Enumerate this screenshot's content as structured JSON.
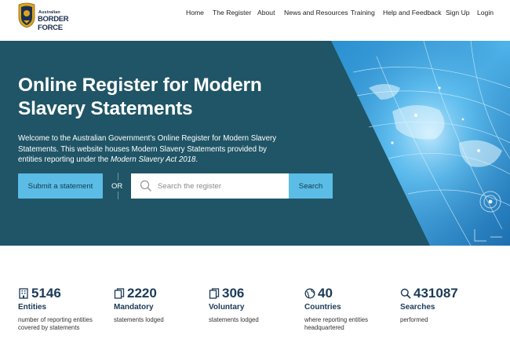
{
  "logo": {
    "small_text": "Australian",
    "big_text": "BORDER FORCE"
  },
  "nav": [
    {
      "label": "Home"
    },
    {
      "label": "The Register"
    },
    {
      "label": "About"
    },
    {
      "label": "News and Resources"
    },
    {
      "label": "Training"
    },
    {
      "label": "Help and Feedback"
    },
    {
      "label": "Sign Up"
    },
    {
      "label": "Login"
    }
  ],
  "hero": {
    "title": "Online Register for Modern Slavery Statements",
    "description": "Welcome to the Australian Government's Online Register for Modern Slavery Statements. This website houses Modern Slavery Statements provided by entities reporting under the ",
    "act_name": "Modern Slavery Act 2018",
    "description_end": ".",
    "submit_label": "Submit a statement",
    "or_label": "OR",
    "search_placeholder": "Search the register",
    "search_label": "Search"
  },
  "colors": {
    "hero_bg": "#1f5566",
    "accent": "#5bbce6",
    "navy": "#1b3a57"
  },
  "stats": [
    {
      "icon": "building-icon",
      "value": "5146",
      "label": "Entities",
      "description": "number of reporting entities covered by statements"
    },
    {
      "icon": "documents-icon",
      "value": "2220",
      "label": "Mandatory",
      "description": "statements lodged"
    },
    {
      "icon": "documents-icon",
      "value": "306",
      "label": "Voluntary",
      "description": "statements lodged"
    },
    {
      "icon": "globe-icon",
      "value": "40",
      "label": "Countries",
      "description": "where reporting entities headquartered"
    },
    {
      "icon": "magnifier-icon",
      "value": "431087",
      "label": "Searches",
      "description": "performed"
    }
  ]
}
